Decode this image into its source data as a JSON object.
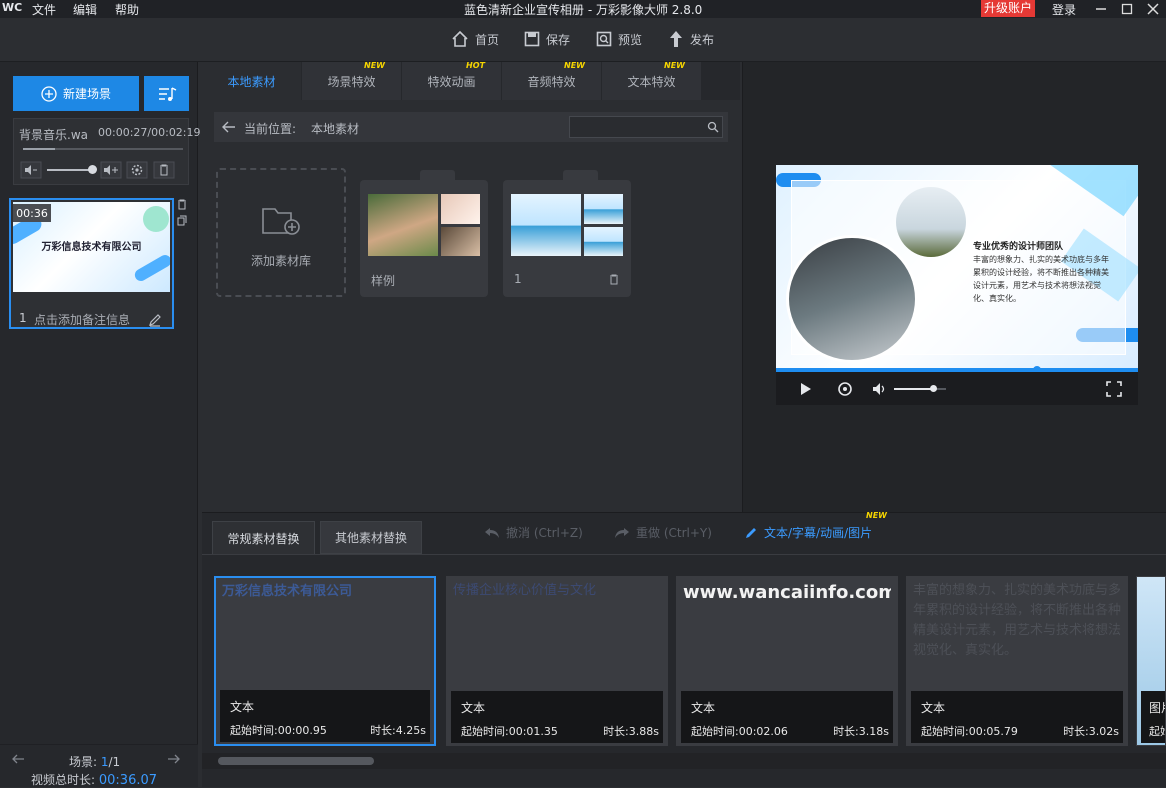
{
  "titlebar": {
    "app_logo": "WC",
    "menu": [
      "文件",
      "编辑",
      "帮助"
    ],
    "title": "蓝色清新企业宣传相册 - 万彩影像大师 2.8.0",
    "upgrade": "升级账户",
    "login": "登录",
    "controls": [
      "minimize",
      "restore",
      "close"
    ]
  },
  "toolbar": {
    "home": "首页",
    "save": "保存",
    "preview": "预览",
    "publish": "发布"
  },
  "left": {
    "new_scene": "新建场景",
    "music_label": "背景音乐.wa",
    "music_time": "00:00:27/00:02:19",
    "scene_duration": "00:36",
    "scene_title": "万彩信息技术有限公司",
    "scene_number": "1",
    "scene_note": "点击添加备注信息",
    "pager_label": "场景:",
    "pager_current": "1",
    "pager_total": "/1",
    "total_label": "视频总时长:",
    "total_value": "00:36.07"
  },
  "tabs": [
    {
      "label": "本地素材",
      "badge": ""
    },
    {
      "label": "场景特效",
      "badge": "NEW"
    },
    {
      "label": "特效动画",
      "badge": "HOT"
    },
    {
      "label": "音频特效",
      "badge": "NEW"
    },
    {
      "label": "文本特效",
      "badge": "NEW"
    }
  ],
  "location": {
    "label": "当前位置:",
    "value": "本地素材",
    "search_placeholder": ""
  },
  "library": {
    "add_label": "添加素材库",
    "folder1": "样例",
    "folder2": "1"
  },
  "preview": {
    "heading": "专业优秀的设计师团队",
    "body": "丰富的想象力、扎实的美术功底与多年累积的设计经验，将不断推出各种精美设计元素，用艺术与技术将想法视觉化、真实化。",
    "progress": 0.72,
    "volume": 0.75
  },
  "bottom": {
    "tab1": "常规素材替换",
    "tab2": "其他素材替换",
    "undo": "撤消 (Ctrl+Z)",
    "redo": "重做 (Ctrl+Y)",
    "text_link": "文本/字幕/动画/图片",
    "text_link_badge": "NEW",
    "tiles": [
      {
        "ghost": "万彩信息技术有限公司",
        "type": "文本",
        "start": "起始时间:00:00.95",
        "dur": "时长:4.25s"
      },
      {
        "ghost": "传播企业核心价值与文化",
        "type": "文本",
        "start": "起始时间:00:01.35",
        "dur": "时长:3.88s"
      },
      {
        "ghost": "www.wancaiinfo.com",
        "type": "文本",
        "start": "起始时间:00:02.06",
        "dur": "时长:3.18s"
      },
      {
        "ghost": "丰富的想象力、扎实的美术功底与多年累积的设计经验，将不断推出各种精美设计元素，用艺术与技术将想法视觉化、真实化。",
        "type": "文本",
        "start": "起始时间:00:05.79",
        "dur": "时长:3.02s"
      },
      {
        "ghost": "",
        "type": "图片",
        "start": "起始",
        "dur": ""
      }
    ]
  }
}
